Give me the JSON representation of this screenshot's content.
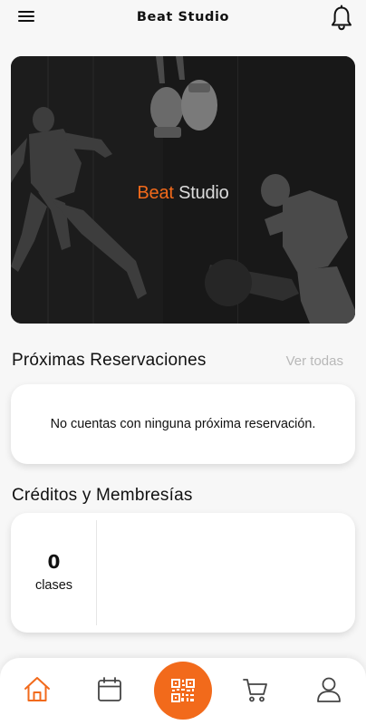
{
  "header": {
    "title": "Beat Studio",
    "menu_icon": "hamburger-menu-icon",
    "notification_icon": "bell-icon"
  },
  "hero": {
    "brand_part1": "Beat",
    "brand_part2": "Studio"
  },
  "reservations": {
    "title": "Próximas Reservaciones",
    "see_all": "Ver todas",
    "empty_message": "No cuentas con ninguna próxima reservación."
  },
  "credits": {
    "title": "Créditos y Membresías",
    "count": "0",
    "unit": "clases"
  },
  "bottom_nav": {
    "items": [
      "home-icon",
      "calendar-icon",
      "qr-code-icon",
      "cart-icon",
      "user-icon"
    ],
    "active": "home-icon"
  },
  "colors": {
    "accent": "#f26a1b",
    "background": "#f7f7f7",
    "muted_text": "#b8b8b8"
  }
}
